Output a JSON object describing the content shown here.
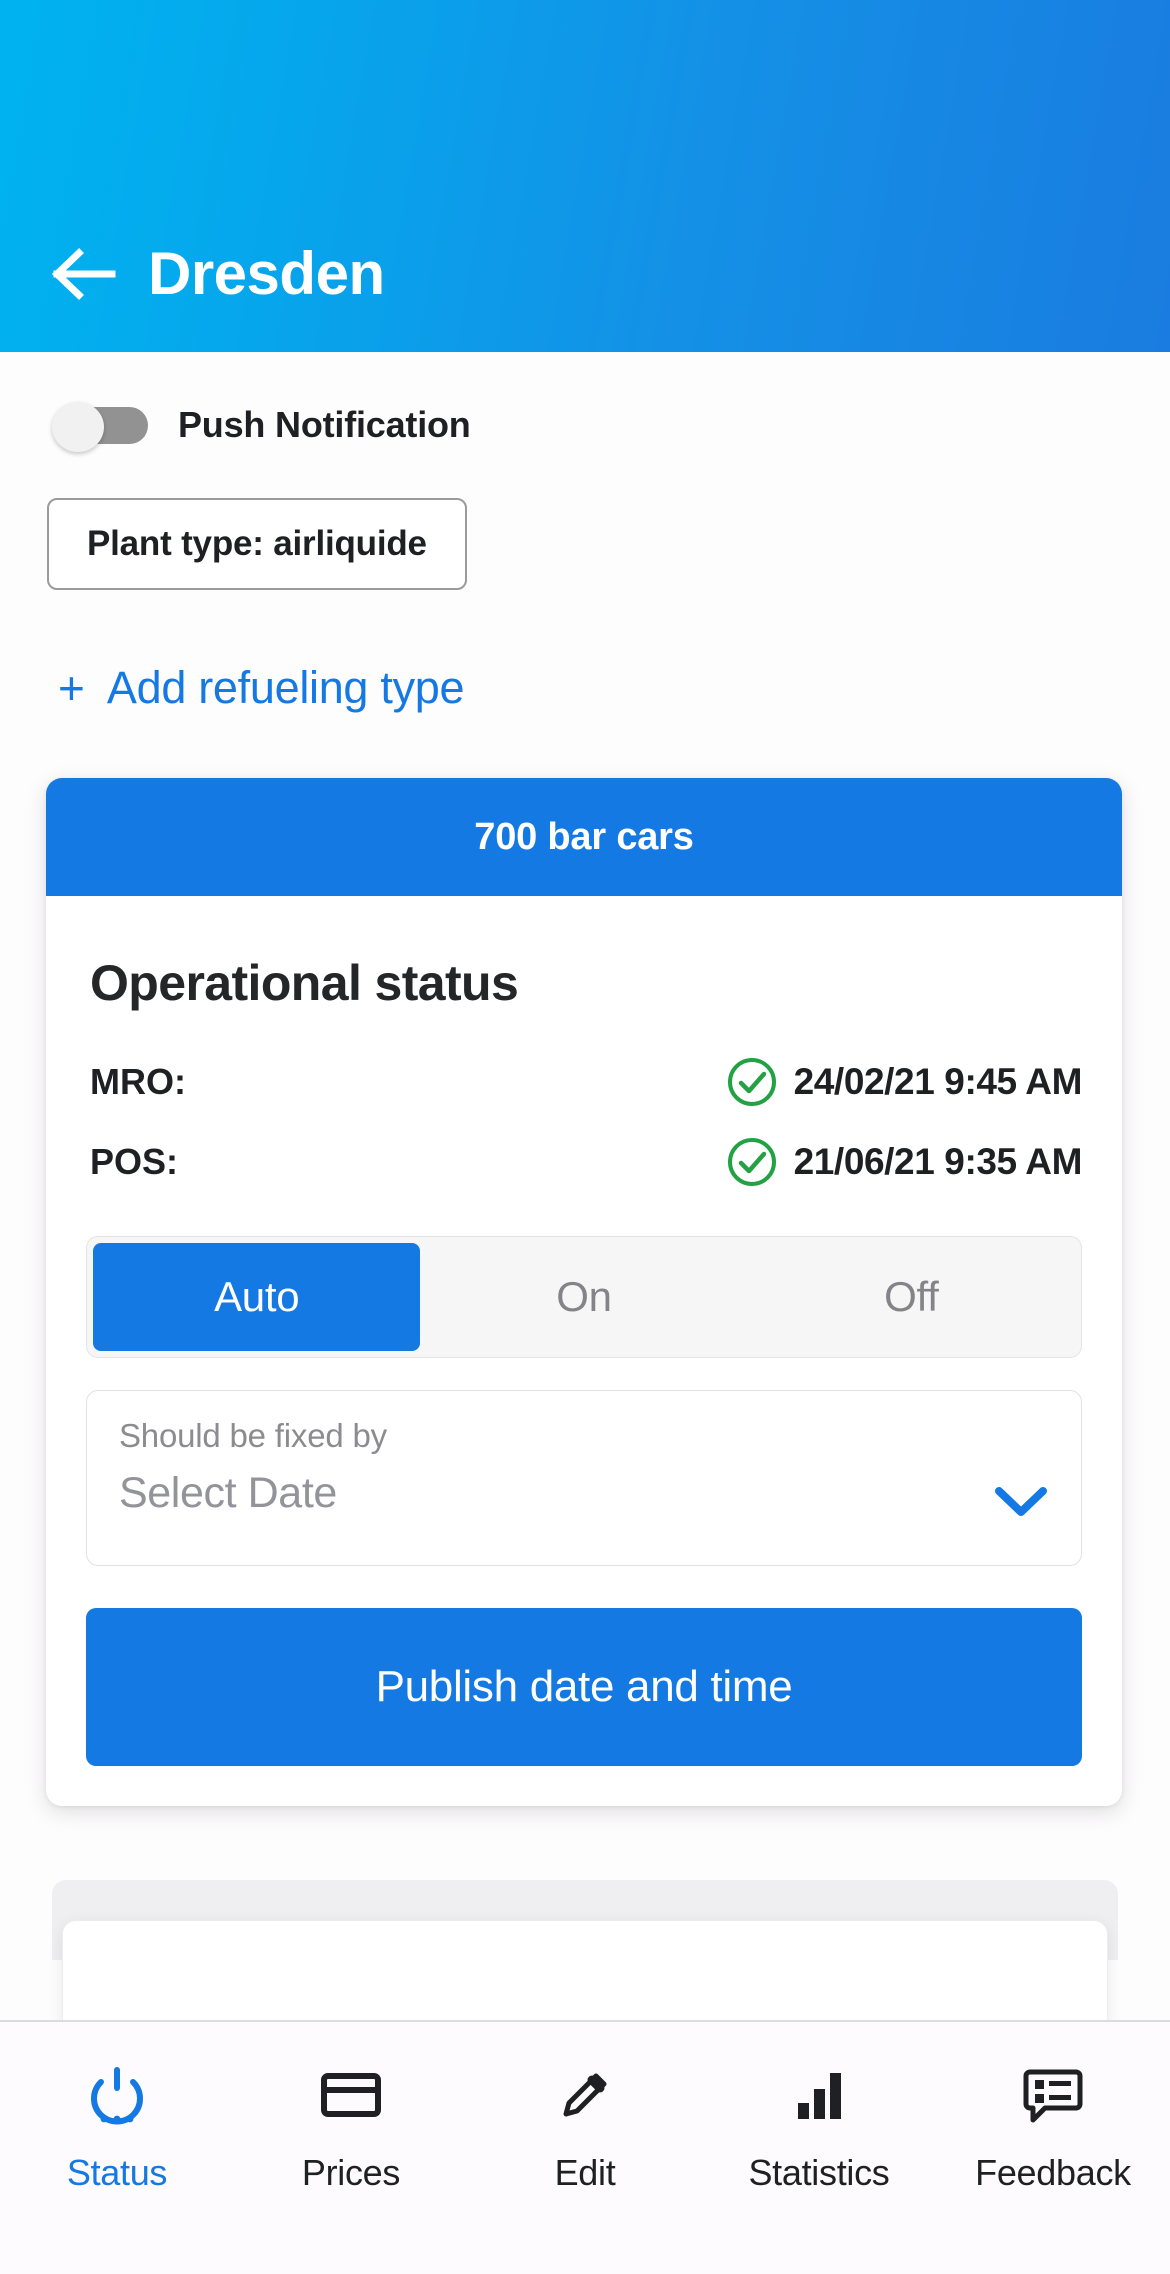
{
  "theme": {
    "accent_blue": "#1479E3",
    "header_gradient_start": "#00B3F0",
    "header_gradient_end": "#1A7CE0",
    "success_green": "#22A243",
    "page_background": "#FEFDFE",
    "muted_text": "#8C8C90"
  },
  "header": {
    "title": "Dresden",
    "back_icon": "arrow-left-icon"
  },
  "settings": {
    "push_notification_label": "Push Notification",
    "push_notification_enabled": false,
    "plant_type_chip": "Plant type: airliquide",
    "add_refueling_type_label": "Add refueling type",
    "add_refueling_plus": "+"
  },
  "card": {
    "header_title": "700 bar cars",
    "section_title": "Operational status",
    "status_rows": [
      {
        "key": "MRO:",
        "icon": "check-circle-icon",
        "value": "24/02/21 9:45 AM"
      },
      {
        "key": "POS:",
        "icon": "check-circle-icon",
        "value": "21/06/21 9:35 AM"
      }
    ],
    "mode_segments": [
      {
        "label": "Auto",
        "selected": true
      },
      {
        "label": "On",
        "selected": false
      },
      {
        "label": "Off",
        "selected": false
      }
    ],
    "date_field": {
      "label": "Should be fixed by",
      "placeholder": "Select Date",
      "chevron_icon": "chevron-down-icon"
    },
    "publish_button_label": "Publish date and time"
  },
  "bottom_nav": {
    "items": [
      {
        "label": "Status",
        "icon": "power-dots-icon",
        "active": true
      },
      {
        "label": "Prices",
        "icon": "credit-card-icon",
        "active": false
      },
      {
        "label": "Edit",
        "icon": "pencil-icon",
        "active": false
      },
      {
        "label": "Statistics",
        "icon": "bar-chart-icon",
        "active": false
      },
      {
        "label": "Feedback",
        "icon": "chat-list-icon",
        "active": false
      }
    ]
  }
}
